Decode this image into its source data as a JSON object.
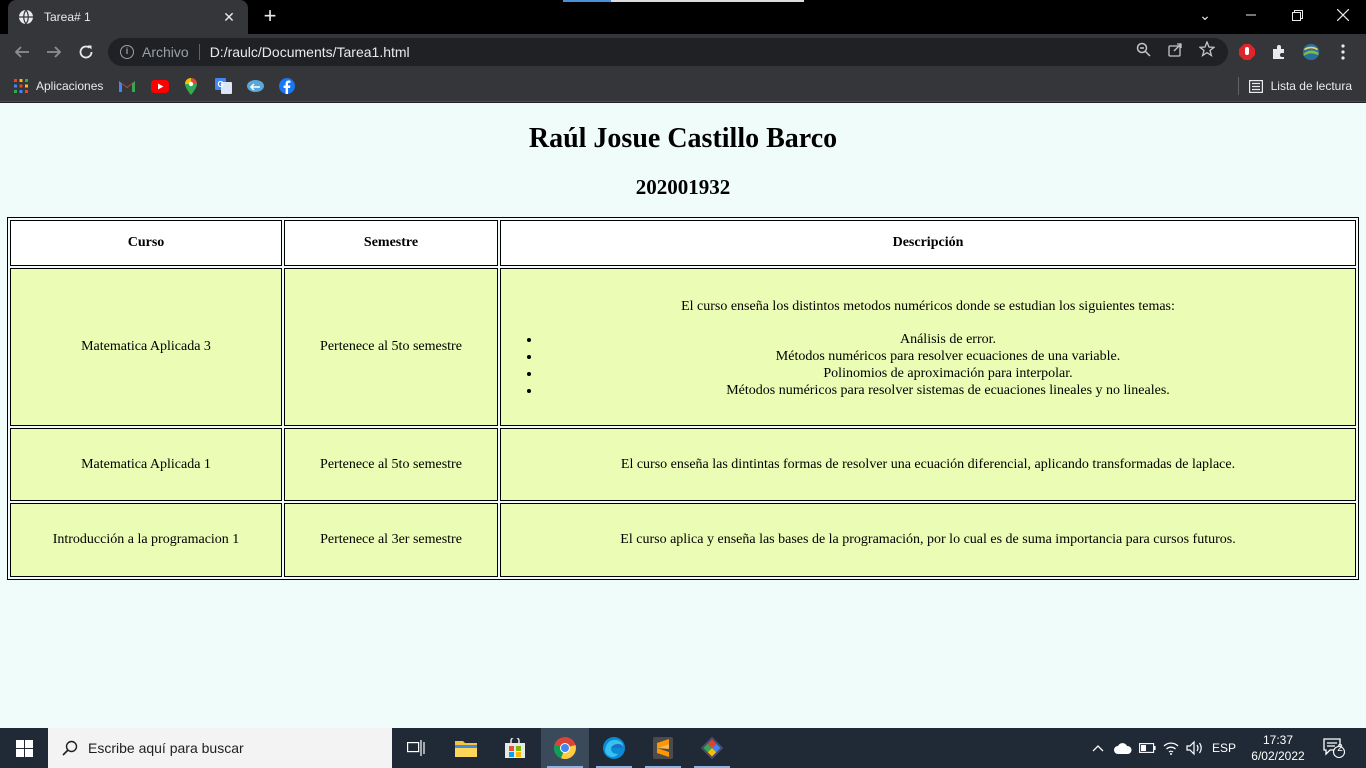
{
  "browser": {
    "tab_title": "Tarea# 1",
    "address_scheme": "Archivo",
    "address_url": "D:/raulc/Documents/Tarea1.html",
    "bookmarks": [
      {
        "label": "Aplicaciones",
        "icon": "apps-grid-icon"
      },
      {
        "label": "",
        "icon": "gmail-icon"
      },
      {
        "label": "",
        "icon": "youtube-icon"
      },
      {
        "label": "",
        "icon": "maps-icon"
      },
      {
        "label": "",
        "icon": "translate-icon"
      },
      {
        "label": "",
        "icon": "cloud-link-icon"
      },
      {
        "label": "",
        "icon": "facebook-icon"
      }
    ],
    "reading_list": "Lista de lectura"
  },
  "page": {
    "title": "Raúl Josue Castillo Barco",
    "subtitle": "202001932",
    "table": {
      "headers": [
        "Curso",
        "Semestre",
        "Descripción"
      ],
      "rows": [
        {
          "course": "Matematica Aplicada 3",
          "semester": "Pertenece al 5to semestre",
          "description": "El curso enseña los distintos metodos numéricos donde se estudian los siguientes temas:",
          "topics": [
            "Análisis de error.",
            "Métodos numéricos para resolver ecuaciones de una variable.",
            "Polinomios de aproximación para interpolar.",
            "Métodos numéricos para resolver sistemas de ecuaciones lineales y no lineales."
          ]
        },
        {
          "course": "Matematica Aplicada 1",
          "semester": "Pertenece al 5to semestre",
          "description": "El curso enseña las dintintas formas de resolver una ecuación diferencial, aplicando transformadas de laplace."
        },
        {
          "course": "Introducción a la programacion 1",
          "semester": "Pertenece al 3er semestre",
          "description": "El curso aplica y enseña las bases de la programación, por lo cual es de suma importancia para cursos futuros."
        }
      ]
    }
  },
  "taskbar": {
    "search_placeholder": "Escribe aquí para buscar",
    "language": "ESP",
    "time": "17:37",
    "date": "6/02/2022",
    "notification_count": "2",
    "apps": [
      "task-view",
      "file-explorer",
      "microsoft-store",
      "chrome",
      "edge",
      "sublime-text",
      "git"
    ]
  },
  "colors": {
    "page_bg": "#f0fcf9",
    "cell_bg": "#ebfcb4",
    "header_bg": "#ffffff"
  }
}
